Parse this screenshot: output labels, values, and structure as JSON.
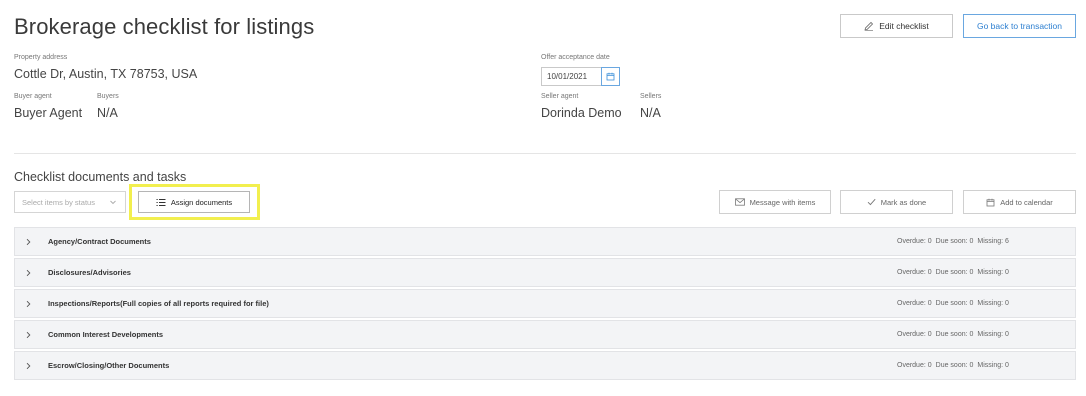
{
  "header": {
    "title": "Brokerage checklist for listings",
    "edit_label": "Edit checklist",
    "back_label": "Go back to transaction"
  },
  "property": {
    "address_label": "Property address",
    "address_value": "Cottle Dr, Austin, TX 78753, USA",
    "offer_label": "Offer acceptance date",
    "offer_value": "10/01/2021"
  },
  "parties": {
    "buyer_agent_label": "Buyer agent",
    "buyer_agent_value": "Buyer Agent",
    "buyers_label": "Buyers",
    "buyers_value": "N/A",
    "seller_agent_label": "Seller agent",
    "seller_agent_value": "Dorinda Demo",
    "sellers_label": "Sellers",
    "sellers_value": "N/A"
  },
  "checklist": {
    "title": "Checklist documents and tasks",
    "status_placeholder": "Select items by status",
    "assign_label": "Assign documents",
    "message_label": "Message with items",
    "done_label": "Mark as done",
    "calendar_label": "Add to calendar"
  },
  "groups": [
    {
      "label": "Agency/Contract Documents",
      "overdue": "Overdue: 0",
      "due": "Due soon: 0",
      "missing": "Missing: 6"
    },
    {
      "label": "Disclosures/Advisories",
      "overdue": "Overdue: 0",
      "due": "Due soon: 0",
      "missing": "Missing: 0"
    },
    {
      "label": "Inspections/Reports(Full copies of all reports required for file)",
      "overdue": "Overdue: 0",
      "due": "Due soon: 0",
      "missing": "Missing: 0"
    },
    {
      "label": "Common Interest Developments",
      "overdue": "Overdue: 0",
      "due": "Due soon: 0",
      "missing": "Missing: 0"
    },
    {
      "label": "Escrow/Closing/Other Documents",
      "overdue": "Overdue: 0",
      "due": "Due soon: 0",
      "missing": "Missing: 0"
    }
  ],
  "colors": {
    "accent": "#2d7fd0",
    "highlight": "#f2ef4e"
  }
}
